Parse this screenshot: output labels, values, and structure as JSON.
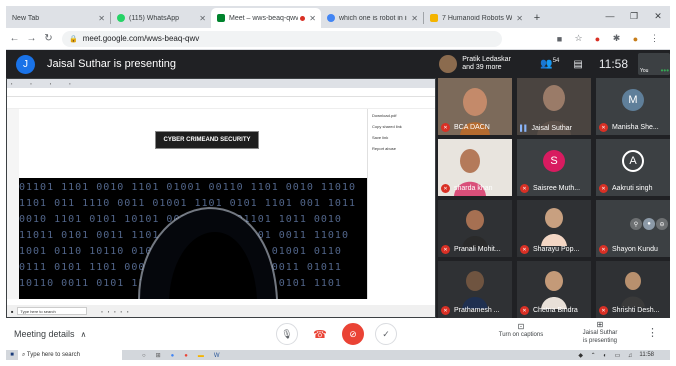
{
  "browser": {
    "tabs": [
      {
        "title": "New Tab",
        "favicon": "#9aa0a6",
        "active": false
      },
      {
        "title": "(115) WhatsApp",
        "favicon": "#25d366",
        "active": false
      },
      {
        "title": "Meet – wws-beaq-qwv",
        "favicon": "#00832d",
        "active": true
      },
      {
        "title": "which one is robot in indic",
        "favicon": "#4285f4",
        "active": false
      },
      {
        "title": "7 Humanoid Robots Which",
        "favicon": "#f4b400",
        "active": false
      }
    ],
    "url": "meet.google.com/wws-beaq-qwv"
  },
  "meet": {
    "presenter_initial": "J",
    "presenting_text": "Jaisal Suthar is presenting",
    "pinned_name_line1": "Pratik Ledaskar",
    "pinned_name_line2": "and 39 more",
    "people_count": "54",
    "time": "11:58",
    "you_label": "You"
  },
  "shared": {
    "banner": "CYBER CRIMEAND SECURITY",
    "panel_items": [
      "Download.pdf",
      "Copy shared link",
      "Save link",
      "Report abuse"
    ],
    "taskbar_search": "Type here to search"
  },
  "participants": [
    {
      "name": "BCA DACN",
      "muted": true,
      "color": "#c48a6a"
    },
    {
      "name": "Jaisal Suthar",
      "muted": false,
      "color": "#9a7b68"
    },
    {
      "name": "Manisha She...",
      "muted": true,
      "avatar": "M",
      "avatar_color": "#5f7f9a"
    },
    {
      "name": "sharda khan",
      "muted": true,
      "color": "#b47a5a"
    },
    {
      "name": "Saisree Muth...",
      "muted": true,
      "avatar": "S",
      "avatar_color": "#d81b60"
    },
    {
      "name": "Aakruti singh",
      "muted": true,
      "avatar": "A",
      "avatar_color": "#3c4043"
    },
    {
      "name": "Pranali Mohit...",
      "muted": true,
      "color": "#4a4a4a"
    },
    {
      "name": "Sharayu Pop...",
      "muted": true,
      "color": "#4a4a4a"
    },
    {
      "name": "Shayon Kundu",
      "muted": true,
      "color": "#3c4043"
    },
    {
      "name": "Prathamesh ...",
      "muted": true,
      "color": "#4a4a4a"
    },
    {
      "name": "Chetna Bindra",
      "muted": true,
      "color": "#4a4a4a"
    },
    {
      "name": "Shrishti Desh...",
      "muted": true,
      "color": "#4a4a4a"
    }
  ],
  "controls": {
    "meeting_details": "Meeting details",
    "captions": "Turn on captions",
    "presenting_line1": "Jaisal Suthar",
    "presenting_line2": "is presenting"
  },
  "taskbar": {
    "search": "Type here to search",
    "time": "11:58"
  },
  "colors": {
    "meet_bg": "#202124",
    "mute_red": "#ea4335",
    "blue": "#1a73e8"
  }
}
